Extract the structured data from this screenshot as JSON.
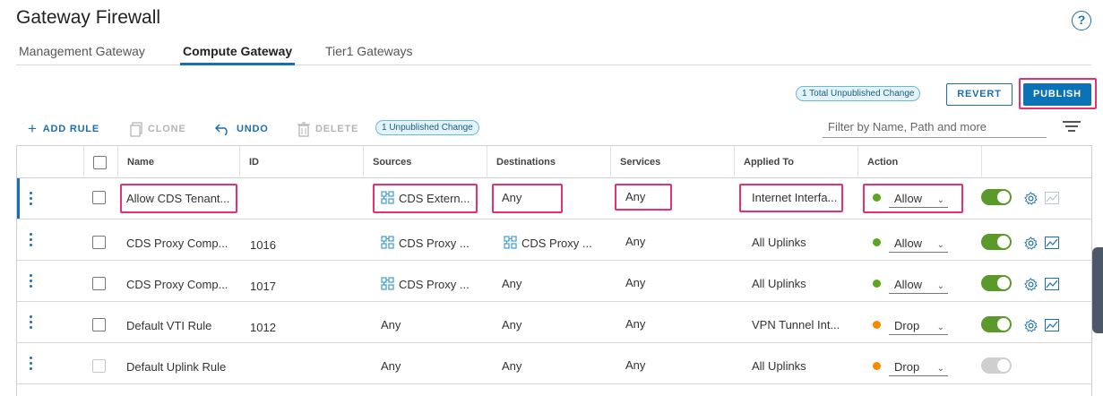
{
  "page": {
    "title": "Gateway Firewall"
  },
  "icons": {
    "help": "help-circle-icon",
    "add": "plus-icon",
    "clone": "copy-icon",
    "undo": "undo-arrow-icon",
    "delete": "trash-icon",
    "filter": "filter-lines-icon",
    "group": "group-icon",
    "settings": "gear-icon",
    "stats": "chart-icon"
  },
  "tabs": [
    {
      "label": "Management Gateway",
      "active": false
    },
    {
      "label": "Compute Gateway",
      "active": true
    },
    {
      "label": "Tier1 Gateways",
      "active": false
    }
  ],
  "header_actions": {
    "total_unpublished": "1 Total Unpublished Change",
    "revert_label": "REVERT",
    "publish_label": "PUBLISH"
  },
  "toolbar": {
    "add_rule_label": "ADD RULE",
    "clone_label": "CLONE",
    "undo_label": "UNDO",
    "delete_label": "DELETE",
    "unpublished_badge": "1 Unpublished Change",
    "filter_placeholder": "Filter by Name, Path and more"
  },
  "columns": [
    "Name",
    "ID",
    "Sources",
    "Destinations",
    "Services",
    "Applied To",
    "Action"
  ],
  "rows": [
    {
      "name": "Allow CDS Tenant...",
      "id": "",
      "sources": "CDS Extern...",
      "sources_group": true,
      "destinations": "Any",
      "destinations_group": false,
      "services": "Any",
      "applied_to": "Internet Interfa...",
      "action": "Allow",
      "action_color": "#5aa621",
      "enabled": true,
      "checkbox_disabled": false,
      "selected": true
    },
    {
      "name": "CDS Proxy Comp...",
      "id": "1016",
      "sources": "CDS Proxy ...",
      "sources_group": true,
      "destinations": "CDS Proxy ...",
      "destinations_group": true,
      "services": "Any",
      "applied_to": "All Uplinks",
      "action": "Allow",
      "action_color": "#5aa621",
      "enabled": true,
      "checkbox_disabled": false,
      "selected": false
    },
    {
      "name": "CDS Proxy Comp...",
      "id": "1017",
      "sources": "CDS Proxy ...",
      "sources_group": true,
      "destinations": "Any",
      "destinations_group": false,
      "services": "Any",
      "applied_to": "All Uplinks",
      "action": "Allow",
      "action_color": "#5aa621",
      "enabled": true,
      "checkbox_disabled": false,
      "selected": false
    },
    {
      "name": "Default VTI Rule",
      "id": "1012",
      "sources": "Any",
      "sources_group": false,
      "destinations": "Any",
      "destinations_group": false,
      "services": "Any",
      "applied_to": "VPN Tunnel Int...",
      "action": "Drop",
      "action_color": "#f38b00",
      "enabled": true,
      "checkbox_disabled": false,
      "selected": false
    },
    {
      "name": "Default Uplink Rule",
      "id": "",
      "sources": "Any",
      "sources_group": false,
      "destinations": "Any",
      "destinations_group": false,
      "services": "Any",
      "applied_to": "All Uplinks",
      "action": "Drop",
      "action_color": "#f38b00",
      "enabled": false,
      "checkbox_disabled": true,
      "selected": false
    }
  ],
  "colors": {
    "accent": "#1b6fb1",
    "highlight": "#e8306f",
    "allow": "#5aa621",
    "drop": "#f38b00",
    "toggle_on": "#5b9a2a"
  }
}
